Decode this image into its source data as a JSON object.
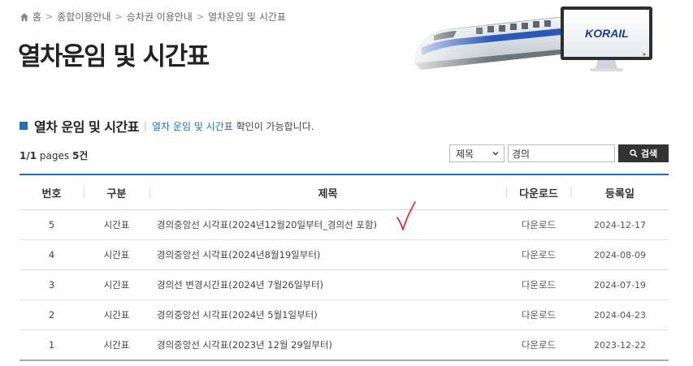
{
  "breadcrumb": {
    "home": "홈",
    "items": [
      "종합이용안내",
      "승차권 이용안내",
      "열차운임 및 시간표"
    ]
  },
  "page_title": "열차운임 및 시간표",
  "brand": {
    "logo_text": "KORAIL",
    "accent": "#1f6fb6"
  },
  "section": {
    "title": "열차 운임 및 시간표",
    "desc_highlight": "열차 운임 및 시간표",
    "desc_rest": " 확인이 가능합니다."
  },
  "listing": {
    "pages": "1/1",
    "pages_label": " pages ",
    "total": "5건"
  },
  "search": {
    "field_selected": "제목",
    "query": "경의",
    "button_label": "검색"
  },
  "table": {
    "headers": [
      "번호",
      "구분",
      "제목",
      "다운로드",
      "등록일"
    ],
    "rows": [
      {
        "no": "5",
        "type": "시간표",
        "title": "경의중앙선 시각표(2024년12월20일부터_경의선 포함)",
        "download": "다운로드",
        "date": "2024-12-17"
      },
      {
        "no": "4",
        "type": "시간표",
        "title": "경의중앙선 시각표(2024년8월19일부터)",
        "download": "다운로드",
        "date": "2024-08-09"
      },
      {
        "no": "3",
        "type": "시간표",
        "title": "경의선 변경시간표(2024년 7월26일부터)",
        "download": "다운로드",
        "date": "2024-07-19"
      },
      {
        "no": "2",
        "type": "시간표",
        "title": "경의중앙선 시각표(2024년 5월1일부터)",
        "download": "다운로드",
        "date": "2024-04-23"
      },
      {
        "no": "1",
        "type": "시간표",
        "title": "경의중앙선 시각표(2023년 12월 29일부터)",
        "download": "다운로드",
        "date": "2023-12-22"
      }
    ]
  },
  "annotation": {
    "color": "#e0202a",
    "icon": "checkmark-annotation-icon"
  }
}
